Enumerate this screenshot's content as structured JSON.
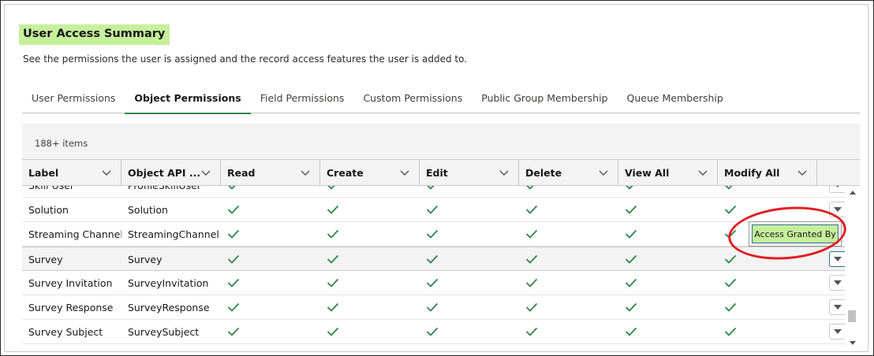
{
  "page": {
    "title": "User Access Summary",
    "subtitle": "See the permissions the user is assigned and the record access features the user is added to."
  },
  "tabs": [
    {
      "label": "User Permissions",
      "active": false
    },
    {
      "label": "Object Permissions",
      "active": true
    },
    {
      "label": "Field Permissions",
      "active": false
    },
    {
      "label": "Custom Permissions",
      "active": false
    },
    {
      "label": "Public Group Membership",
      "active": false
    },
    {
      "label": "Queue Membership",
      "active": false
    }
  ],
  "table": {
    "item_count": "188+ items",
    "columns": [
      "Label",
      "Object API ...",
      "Read",
      "Create",
      "Edit",
      "Delete",
      "View All",
      "Modify All"
    ],
    "rows": [
      {
        "label": "Skill User",
        "api": "ProfileSkillUser",
        "read": true,
        "create": true,
        "edit": true,
        "delete": true,
        "view_all": true,
        "modify_all": true
      },
      {
        "label": "Solution",
        "api": "Solution",
        "read": true,
        "create": true,
        "edit": true,
        "delete": true,
        "view_all": true,
        "modify_all": true
      },
      {
        "label": "Streaming Channel",
        "api": "StreamingChannel",
        "read": true,
        "create": true,
        "edit": true,
        "delete": true,
        "view_all": true,
        "modify_all": true
      },
      {
        "label": "Survey",
        "api": "Survey",
        "read": true,
        "create": true,
        "edit": true,
        "delete": true,
        "view_all": true,
        "modify_all": true
      },
      {
        "label": "Survey Invitation",
        "api": "SurveyInvitation",
        "read": true,
        "create": true,
        "edit": true,
        "delete": true,
        "view_all": true,
        "modify_all": true
      },
      {
        "label": "Survey Response",
        "api": "SurveyResponse",
        "read": true,
        "create": true,
        "edit": true,
        "delete": true,
        "view_all": true,
        "modify_all": true
      },
      {
        "label": "Survey Subject",
        "api": "SurveySubject",
        "read": true,
        "create": true,
        "edit": true,
        "delete": true,
        "view_all": true,
        "modify_all": true
      }
    ]
  },
  "popup": {
    "label": "Access Granted By"
  },
  "colors": {
    "accent_green": "#2e844a",
    "highlight": "#c6ef9b",
    "annotation_red": "#e31b23"
  },
  "icons": {
    "check": "check-icon",
    "chevron": "chevron-down-icon",
    "action": "row-action-dropdown-icon"
  }
}
